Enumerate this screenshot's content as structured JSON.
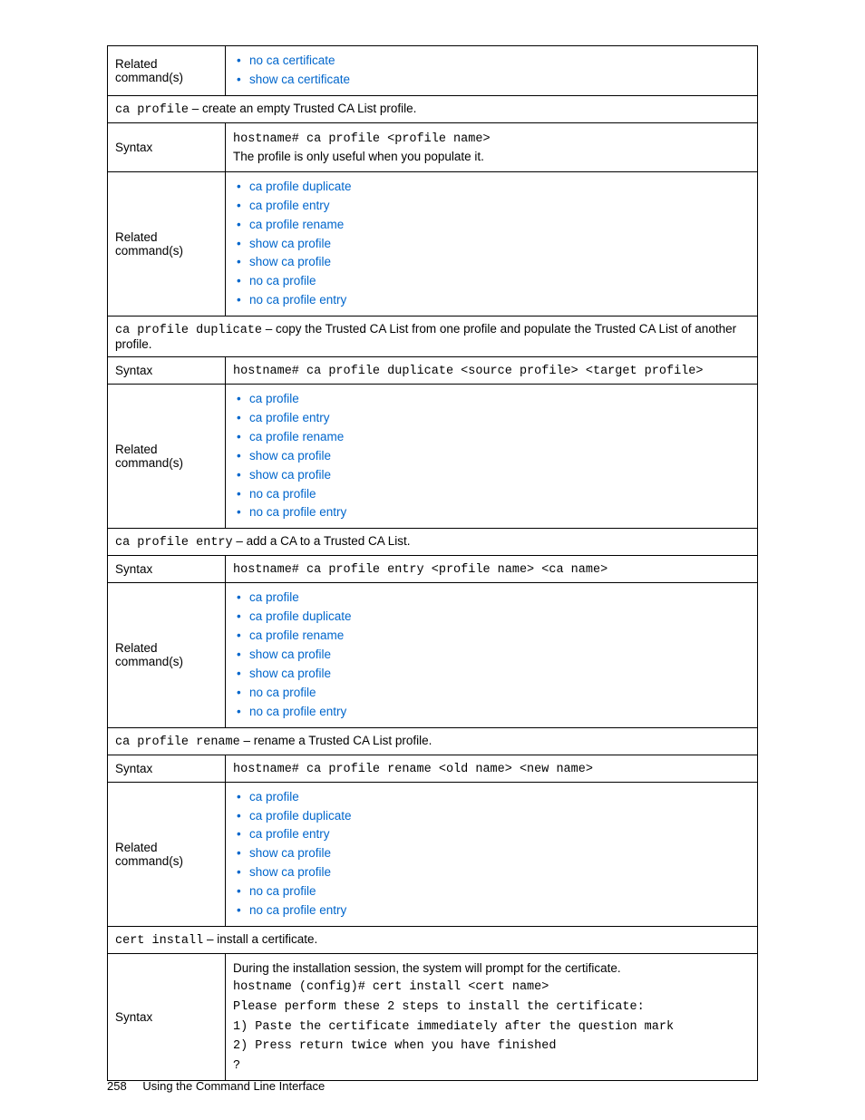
{
  "labels": {
    "related": "Related command(s)",
    "syntax": "Syntax"
  },
  "rows": {
    "r1_list": [
      "no ca certificate",
      "show ca certificate"
    ],
    "r2_cmd": "ca profile",
    "r2_desc": " – create an empty Trusted CA List profile.",
    "r3_code": "hostname# ca profile <profile name>",
    "r3_text": "The profile is only useful when you populate it.",
    "r4_list": [
      "ca profile duplicate",
      "ca profile entry",
      "ca profile rename",
      "show ca profile",
      "show ca profile",
      "no ca profile",
      "no ca profile entry"
    ],
    "r5_cmd": "ca profile duplicate",
    "r5_desc": " – copy the Trusted CA List from one profile and populate the Trusted CA List of another profile.",
    "r6_code": "hostname# ca profile duplicate <source profile> <target profile>",
    "r7_list": [
      "ca profile",
      "ca profile entry",
      "ca profile rename",
      "show ca profile",
      "show ca profile",
      "no ca profile",
      "no ca profile entry"
    ],
    "r8_cmd": "ca profile entry",
    "r8_desc": " – add a CA to a Trusted CA List.",
    "r9_code": "hostname# ca profile entry <profile name> <ca name>",
    "r10_list": [
      "ca profile",
      "ca profile duplicate",
      "ca profile rename",
      "show ca profile",
      "show ca profile",
      "no ca profile",
      "no ca profile entry"
    ],
    "r11_cmd": "ca profile rename",
    "r11_desc": " – rename a Trusted CA List profile.",
    "r12_code": "hostname# ca profile rename <old name> <new name>",
    "r13_list": [
      "ca profile",
      "ca profile duplicate",
      "ca profile entry",
      "show ca profile",
      "show ca profile",
      "no ca profile",
      "no ca profile entry"
    ],
    "r14_cmd": "cert install",
    "r14_desc": " – install a certificate.",
    "r15_text": "During the installation session, the system will prompt for the certificate.",
    "r15_code1": "hostname (config)# cert install <cert name>",
    "r15_code2": "Please perform these 2 steps to install the certificate:",
    "r15_code3": "1) Paste the certificate immediately after the question mark",
    "r15_code4": "2) Press return twice when you have finished",
    "r15_code5": "?"
  },
  "footer": {
    "page": "258",
    "title": "Using the Command Line Interface"
  }
}
